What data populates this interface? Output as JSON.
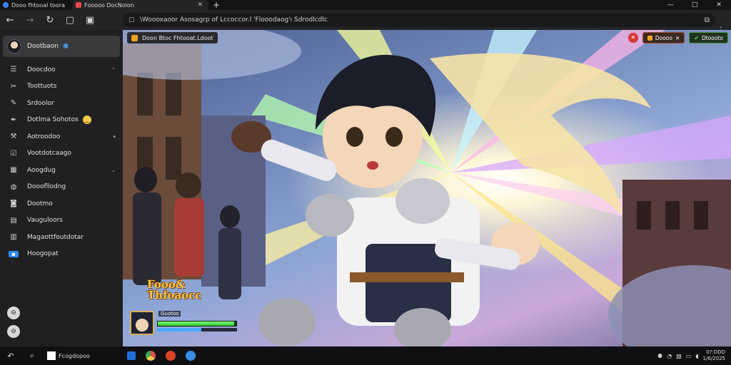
{
  "browser": {
    "tabs": [
      {
        "label": "Dooo fhtooal toora"
      },
      {
        "label": "Fooooo DocNolon"
      }
    ],
    "new_tab": "+",
    "window_controls": [
      "—",
      "□",
      "✕"
    ],
    "address": "\\Woooxaoor Asosagrp of Lccoccor.l 'Flooodaog'ı  Sdrodlcdlc",
    "address_right_icon": "open-in-icon"
  },
  "sidebar": {
    "profile": {
      "name": "Dootbaon"
    },
    "items": [
      {
        "label": "Doocdoo",
        "icon": "list-icon",
        "chevron": true
      },
      {
        "label": "Toottuots",
        "icon": "wrench-icon",
        "chevron": false
      },
      {
        "label": "Srdoolor",
        "icon": "brush-icon",
        "chevron": false
      },
      {
        "label": "Dotlma Sohotos",
        "icon": "pen-icon",
        "chevron": false,
        "emoji": true
      },
      {
        "label": "Aotroodoo",
        "icon": "tool-icon",
        "chevron": true
      },
      {
        "label": "Vootdotcaago",
        "icon": "checkbox-icon",
        "chevron": false
      },
      {
        "label": "Aoogdug",
        "icon": "image-icon",
        "chevron": true
      },
      {
        "label": "Dooofllodng",
        "icon": "globe-icon",
        "chevron": false
      },
      {
        "label": "Dootmo",
        "icon": "camera-icon",
        "chevron": false
      },
      {
        "label": "Vauguloors",
        "icon": "window-icon",
        "chevron": false
      },
      {
        "label": "Magaottfoutdotar",
        "icon": "layout-icon",
        "chevron": false
      },
      {
        "label": "Hoogopat",
        "icon": "app-icon",
        "chevron": false
      }
    ]
  },
  "game": {
    "top_left_label": "Doon   Btoc  Fhtooat.Ldoot",
    "top_right": [
      {
        "label": "Doooo"
      },
      {
        "label": "Dtoooto"
      }
    ],
    "logo_line1": "Fooo&",
    "logo_line2": "Thfoaocc",
    "hud_name": "Guotoo",
    "hp_fraction": 0.97,
    "mp_fraction": 0.55
  },
  "taskbar": {
    "search_label": "Fcogdopoo",
    "time": "0?:DDD",
    "date": "1/6/2025"
  },
  "colors": {
    "sidebar_bg": "#202022",
    "accent": "#4aa8ff",
    "hud_green": "#2ec42e"
  }
}
